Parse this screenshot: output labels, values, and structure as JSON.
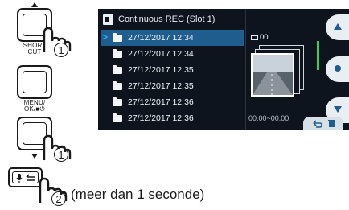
{
  "buttons": {
    "shortcut_label": "SHORTCUT",
    "shortcut_label_line1": "SHORT",
    "shortcut_label_line2": "CUT",
    "menu_label_line1": "MENU/",
    "menu_label_line2": "OK/■⏻",
    "step1": "1",
    "step2": "2"
  },
  "caption": "(meer dan 1 seconde)",
  "screen": {
    "title": "Continuous REC (Slot 1)",
    "files": [
      {
        "label": "27/12/2017  12:34",
        "selected": true
      },
      {
        "label": "27/12/2017  12:34",
        "selected": false
      },
      {
        "label": "27/12/2017  12:35",
        "selected": false
      },
      {
        "label": "27/12/2017  12:35",
        "selected": false
      },
      {
        "label": "27/12/2017  12:36",
        "selected": false
      },
      {
        "label": "27/12/2017  12:36",
        "selected": false
      }
    ],
    "count": "00",
    "timecode": "00:00~00:00",
    "cursor": ">",
    "colors": {
      "background": "#0d141d",
      "selection": "#1f5d8f",
      "accent": "#2fd25a"
    }
  },
  "icons": [
    "finger-press-icon",
    "folder-icon",
    "up-arrow-icon",
    "down-arrow-icon",
    "record-dot-icon",
    "back-icon",
    "delete-icon",
    "voice-back-icon"
  ]
}
